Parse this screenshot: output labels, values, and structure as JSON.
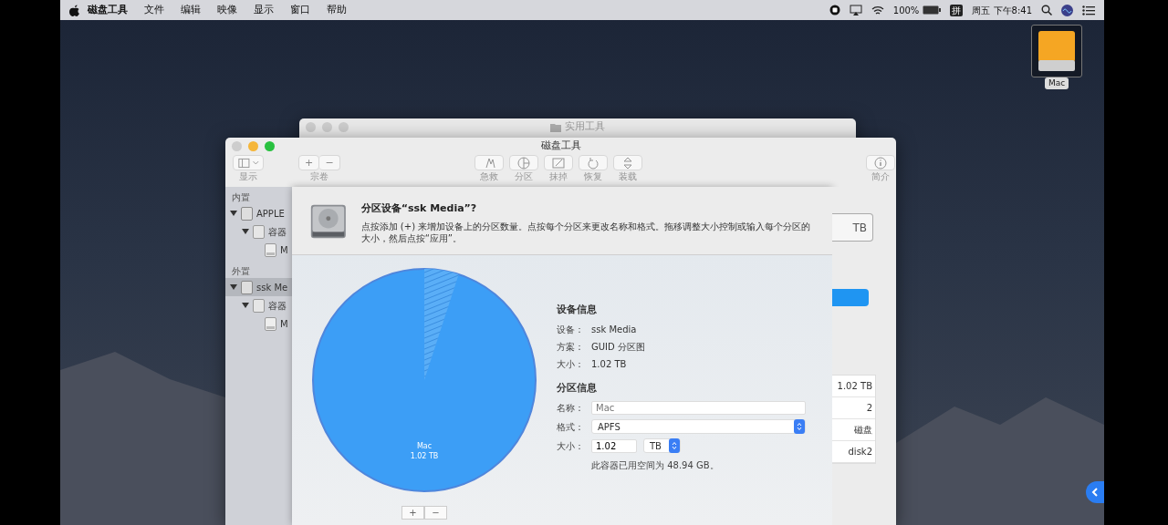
{
  "menu_bar": {
    "items": [
      "磁盘工具",
      "文件",
      "编辑",
      "映像",
      "显示",
      "窗口",
      "帮助"
    ],
    "battery": "100%",
    "input_method": "拼",
    "clock": "周五 下午8:41"
  },
  "desktop_icons": [
    {
      "label": "Mac"
    }
  ],
  "back_window": {
    "title": "实用工具"
  },
  "window": {
    "title": "磁盘工具"
  },
  "toolbar": [
    {
      "kind": "view",
      "label": "显示",
      "disabled": true
    },
    {
      "kind": "volume",
      "label": "宗卷",
      "buttons": [
        "+",
        "−"
      ],
      "disabled": true
    },
    {
      "kind": "firstaid",
      "label": "急救",
      "disabled": true
    },
    {
      "kind": "partition",
      "label": "分区",
      "disabled": true
    },
    {
      "kind": "erase",
      "label": "抹掉",
      "disabled": true
    },
    {
      "kind": "restore",
      "label": "恢复",
      "disabled": true
    },
    {
      "kind": "mount",
      "label": "装载",
      "disabled": true
    },
    {
      "kind": "info",
      "label": "简介",
      "disabled": true
    }
  ],
  "sidebar": {
    "sections": [
      {
        "title": "内置",
        "items": [
          {
            "label": "APPLE",
            "kind": "disk",
            "selected": false,
            "expanded": true,
            "children": [
              {
                "label": "容器",
                "kind": "container",
                "selected": false,
                "expanded": true,
                "children": [
                  {
                    "label": "M",
                    "kind": "volume",
                    "selected": false
                  }
                ]
              }
            ]
          }
        ]
      },
      {
        "title": "外置",
        "items": [
          {
            "label": "ssk Me",
            "kind": "disk",
            "selected": true,
            "expanded": true,
            "children": [
              {
                "label": "容器",
                "kind": "container",
                "selected": false,
                "expanded": true,
                "children": [
                  {
                    "label": "M",
                    "kind": "volume",
                    "selected": false
                  }
                ]
              }
            ]
          }
        ]
      }
    ]
  },
  "background_panel": {
    "size_field": "TB",
    "table": [
      "1.02 TB",
      "2",
      "磁盘",
      "disk2"
    ]
  },
  "sheet": {
    "title": "分区设备“ssk Media”?",
    "description": "点按添加 (+) 来增加设备上的分区数量。点按每个分区来更改名称和格式。拖移调整大小控制或输入每个分区的大小，然后点按“应用”。",
    "partitions": [
      {
        "name": "Mac",
        "size": "1.02 TB"
      }
    ],
    "pie_buttons": [
      "+",
      "−"
    ],
    "device_info": {
      "title": "设备信息",
      "rows": [
        {
          "label": "设备：",
          "value": "ssk Media"
        },
        {
          "label": "方案：",
          "value": "GUID 分区图"
        },
        {
          "label": "大小：",
          "value": "1.02 TB"
        }
      ]
    },
    "partition_info": {
      "title": "分区信息",
      "name_label": "名称：",
      "name_placeholder": "Mac",
      "format_label": "格式：",
      "format": "APFS",
      "size_label": "大小：",
      "size": "1.02",
      "unit": "TB",
      "note": "此容器已用空间为 48.94 GB。"
    }
  }
}
